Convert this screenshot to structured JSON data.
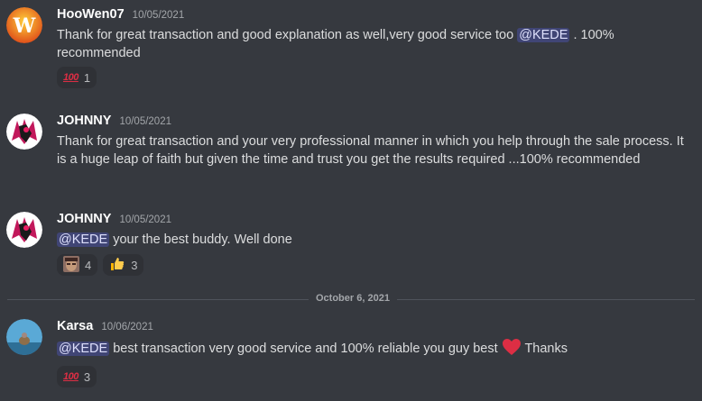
{
  "messages": [
    {
      "username": "HooWen07",
      "timestamp": "10/05/2021",
      "avatar_letter": "W",
      "text_before": "Thank for great transaction and good explanation as well,very good service too ",
      "mention": "@KEDE",
      "text_after": " . 100% recommended",
      "reactions": [
        {
          "emoji": "100-icon",
          "count": "1"
        }
      ]
    },
    {
      "username": "JOHNNY",
      "timestamp": "10/05/2021",
      "text": "Thank for great transaction and your very professional manner in which you help through the sale process. It is a huge leap of faith but given the time and trust you get the results required ...100% recommended"
    },
    {
      "username": "JOHNNY",
      "timestamp": "10/05/2021",
      "mention": "@KEDE",
      "text_after": "  your the best buddy. Well done",
      "reactions": [
        {
          "emoji": "face-icon",
          "count": "4"
        },
        {
          "emoji": "thumbs-up-icon",
          "count": "3"
        }
      ]
    },
    {
      "username": "Karsa",
      "timestamp": "10/06/2021",
      "mention": "@KEDE",
      "text_after": " best transaction  very good service and 100% reliable you guy best ",
      "text_end": " Thanks",
      "reactions": [
        {
          "emoji": "100-icon",
          "count": "3"
        }
      ]
    }
  ],
  "divider_label": "October 6, 2021",
  "colors": {
    "background": "#36393f",
    "mention_bg": "#414675",
    "username": "#ffffff",
    "text": "#dcddde",
    "timestamp": "#a3a6aa"
  }
}
